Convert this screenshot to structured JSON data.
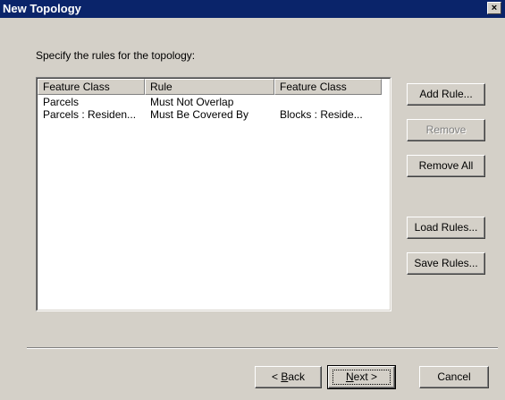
{
  "window": {
    "title": "New Topology",
    "close_glyph": "×"
  },
  "instruction": "Specify the rules for the topology:",
  "table": {
    "columns": [
      "Feature Class",
      "Rule",
      "Feature Class"
    ],
    "rows": [
      [
        "Parcels",
        "Must Not Overlap",
        ""
      ],
      [
        "Parcels : Residen...",
        "Must Be Covered By",
        "Blocks : Reside..."
      ]
    ]
  },
  "side_buttons": {
    "add_rule": "Add Rule...",
    "remove": "Remove",
    "remove_all": "Remove All",
    "load_rules": "Load Rules...",
    "save_rules": "Save Rules..."
  },
  "nav": {
    "back_prefix": "< ",
    "back_key": "B",
    "back_rest": "ack",
    "next_key": "N",
    "next_rest": "ext >",
    "cancel": "Cancel"
  },
  "colors": {
    "title_bar": "#0a246a",
    "face": "#d4d0c8",
    "disabled_text": "#808080"
  }
}
